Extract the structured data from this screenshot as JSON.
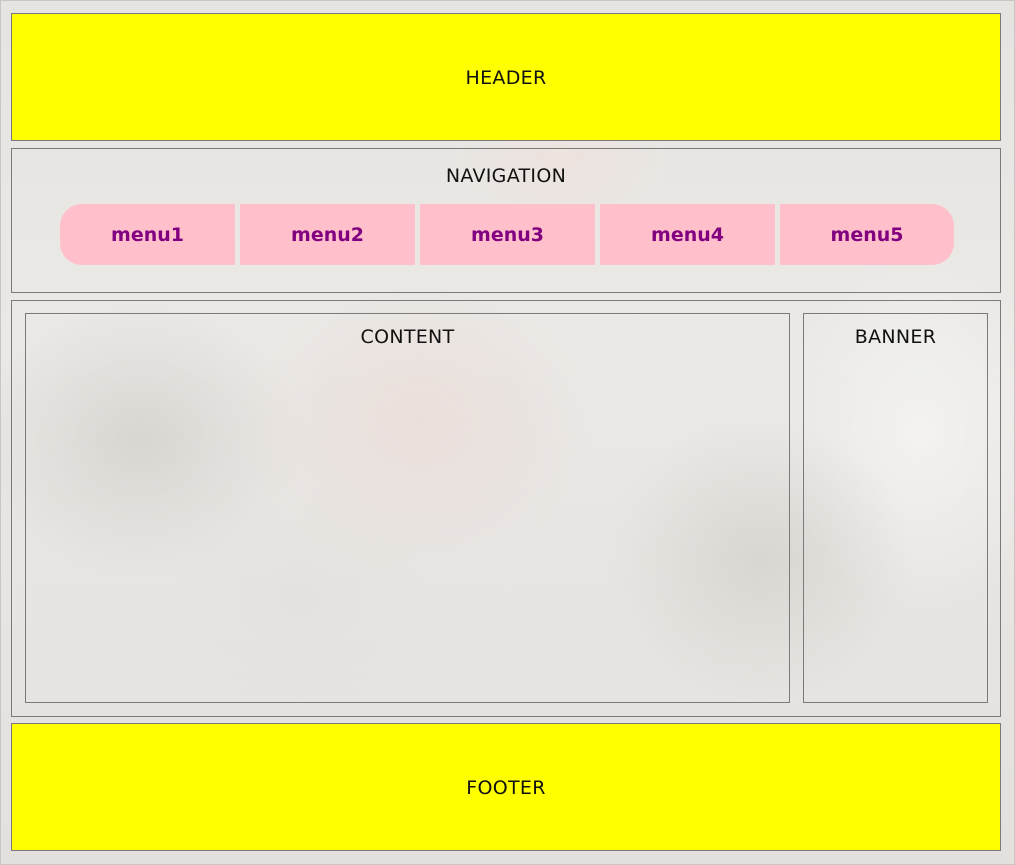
{
  "header": {
    "title": "HEADER",
    "bg_color": "#ffff00"
  },
  "navigation": {
    "title": "NAVIGATION",
    "menu_items": [
      {
        "label": "menu1"
      },
      {
        "label": "menu2"
      },
      {
        "label": "menu3"
      },
      {
        "label": "menu4"
      },
      {
        "label": "menu5"
      }
    ],
    "menu_bg_color": "#ffc0cb",
    "menu_text_color": "#800080"
  },
  "content": {
    "title": "CONTENT"
  },
  "banner": {
    "title": "BANNER"
  },
  "footer": {
    "title": "FOOTER",
    "bg_color": "#ffff00"
  }
}
